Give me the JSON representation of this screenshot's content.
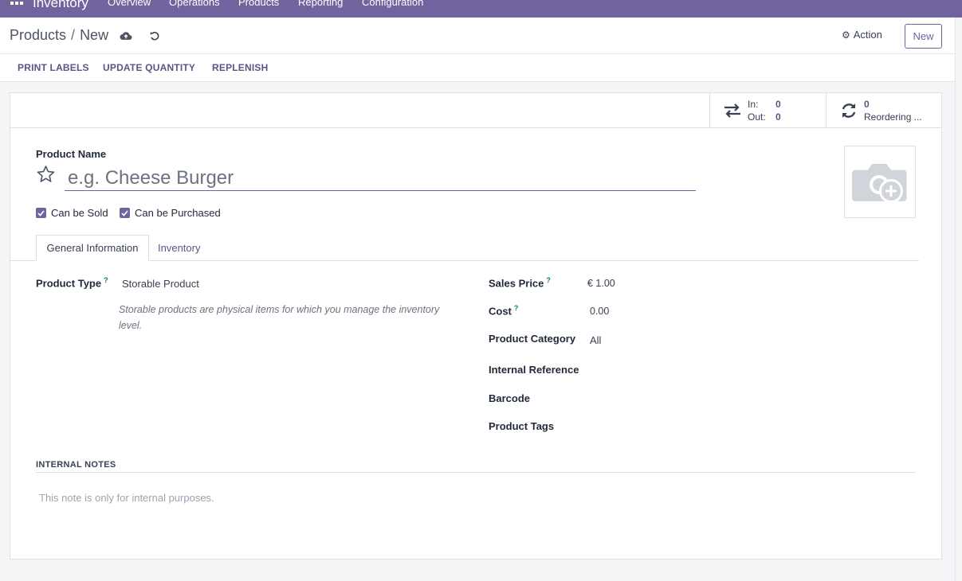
{
  "navbar": {
    "brand": "Inventory",
    "menu": [
      "Overview",
      "Operations",
      "Products",
      "Reporting",
      "Configuration"
    ]
  },
  "control": {
    "breadcrumb_parent": "Products",
    "breadcrumb_separator": "/",
    "breadcrumb_current": "New",
    "action_label": "Action",
    "new_label": "New"
  },
  "buttons": {
    "print_labels": "PRINT LABELS",
    "update_quantity": "UPDATE QUANTITY",
    "replenish": "REPLENISH"
  },
  "stats": {
    "in_label": "In:",
    "in_value": "0",
    "out_label": "Out:",
    "out_value": "0",
    "reorder_value": "0",
    "reorder_label": "Reordering ..."
  },
  "form": {
    "name_label": "Product Name",
    "name_placeholder": "e.g. Cheese Burger",
    "can_be_sold": "Can be Sold",
    "can_be_purchased": "Can be Purchased",
    "tabs": [
      "General Information",
      "Inventory"
    ],
    "product_type_label": "Product Type",
    "product_type_value": "Storable Product",
    "product_type_desc": "Storable products are physical items for which you manage the inventory level.",
    "sales_price_label": "Sales Price",
    "sales_price_value": "€ 1.00",
    "cost_label": "Cost",
    "cost_value": "0.00",
    "category_label": "Product Category",
    "category_value": "All",
    "internal_ref_label": "Internal Reference",
    "barcode_label": "Barcode",
    "tags_label": "Product Tags",
    "help_mark": "?",
    "notes_title": "INTERNAL NOTES",
    "notes_placeholder": "This note is only for internal purposes."
  },
  "colors": {
    "brand": "#71639e",
    "accent_text": "#5d5486",
    "help": "#017e84"
  }
}
